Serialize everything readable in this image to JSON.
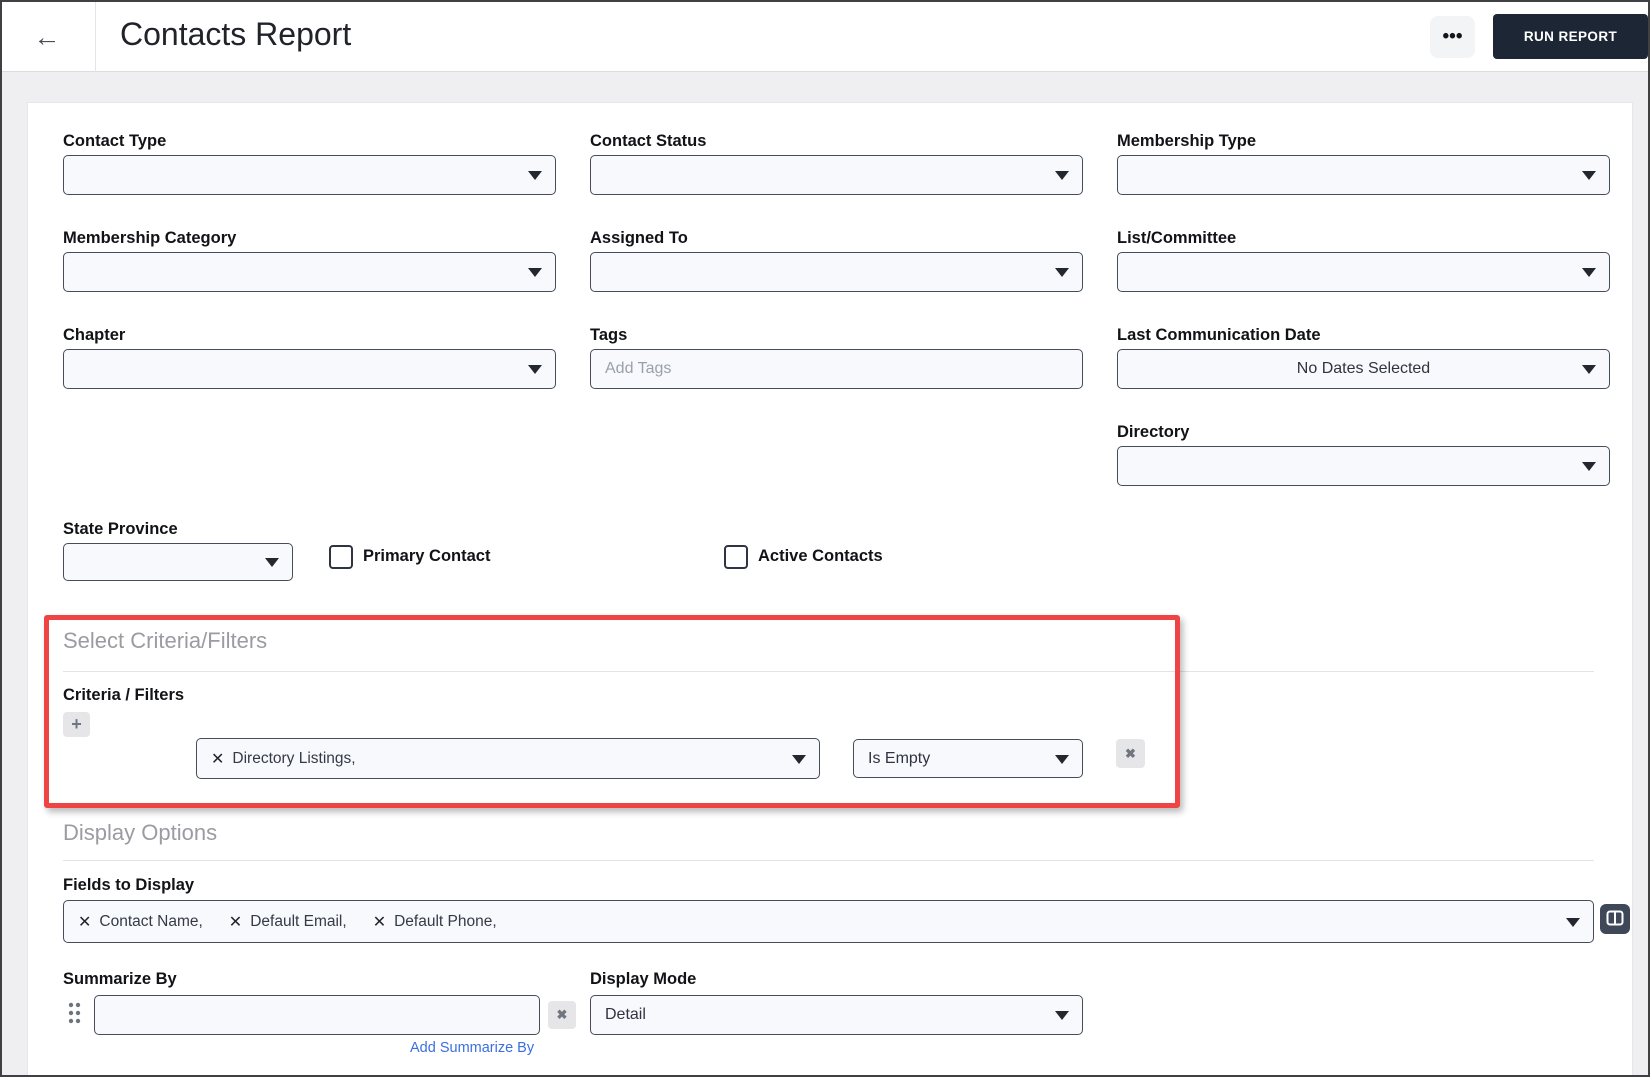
{
  "header": {
    "title": "Contacts Report",
    "run_report_label": "RUN REPORT"
  },
  "icons": {
    "back": "←",
    "more": "•••",
    "plus": "+",
    "chip_remove": "✕",
    "row_remove": "✖"
  },
  "filters": {
    "contact_type": {
      "label": "Contact Type",
      "value": ""
    },
    "contact_status": {
      "label": "Contact Status",
      "value": ""
    },
    "membership_type": {
      "label": "Membership Type",
      "value": ""
    },
    "membership_category": {
      "label": "Membership Category",
      "value": ""
    },
    "assigned_to": {
      "label": "Assigned To",
      "value": ""
    },
    "list_committee": {
      "label": "List/Committee",
      "value": ""
    },
    "chapter": {
      "label": "Chapter",
      "value": ""
    },
    "tags": {
      "label": "Tags",
      "placeholder": "Add Tags",
      "value": ""
    },
    "last_communication_date": {
      "label": "Last Communication Date",
      "value": "No Dates Selected"
    },
    "directory": {
      "label": "Directory",
      "value": ""
    },
    "state_province": {
      "label": "State Province",
      "value": ""
    },
    "primary_contact": {
      "label": "Primary Contact",
      "checked": false
    },
    "active_contacts": {
      "label": "Active Contacts",
      "checked": false
    }
  },
  "criteria_section": {
    "heading": "Select Criteria/Filters",
    "label": "Criteria / Filters",
    "rows": [
      {
        "field": "Directory Listings,",
        "operator": "Is Empty"
      }
    ]
  },
  "display_options": {
    "heading": "Display Options",
    "fields_to_display": {
      "label": "Fields to Display",
      "items": [
        "Contact Name,",
        "Default Email,",
        "Default Phone,"
      ]
    },
    "summarize_by": {
      "label": "Summarize By",
      "value": "",
      "add_link": "Add Summarize By"
    },
    "display_mode": {
      "label": "Display Mode",
      "value": "Detail"
    }
  },
  "colors": {
    "accent_red": "#ee4444",
    "button_dark": "#1c2634",
    "link_blue": "#3b6fe0",
    "control_bg": "#f7f9fc"
  }
}
